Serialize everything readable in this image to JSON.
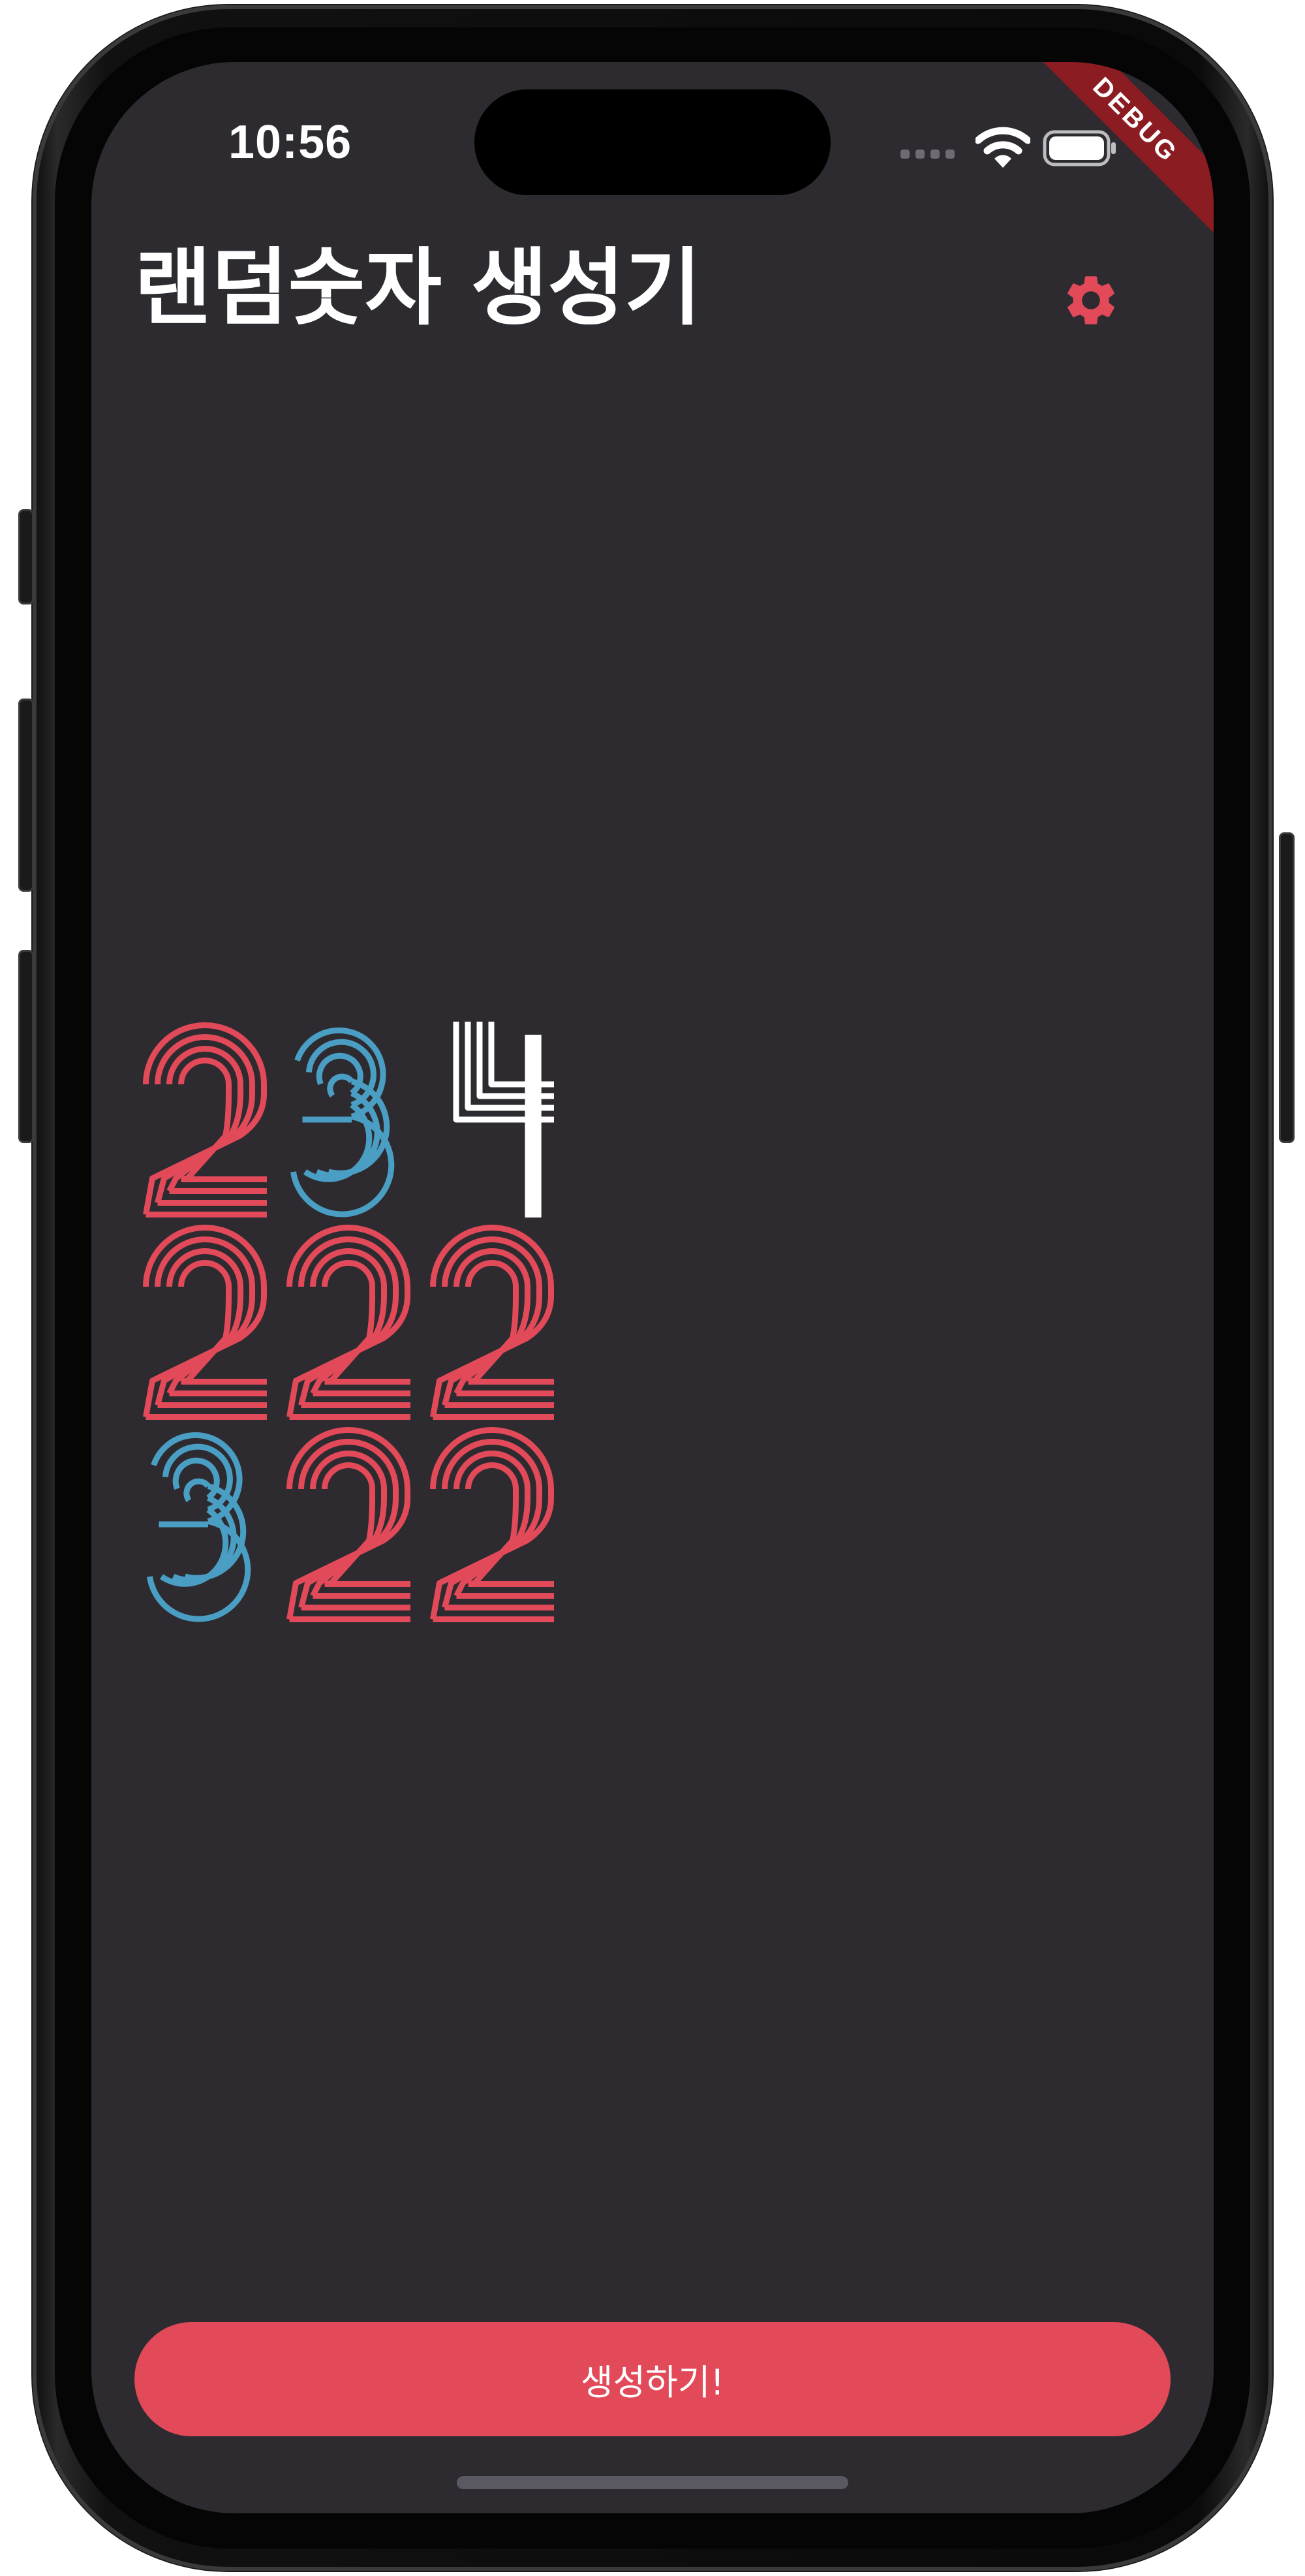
{
  "status_bar": {
    "time": "10:56"
  },
  "debug_banner": "DEBUG",
  "app_bar": {
    "title": "랜덤숫자 생성기",
    "settings_icon": "gear-icon"
  },
  "digit_grid": {
    "rows": [
      [
        "2",
        "3",
        "4"
      ],
      [
        "2",
        "2",
        "2"
      ],
      [
        "3",
        "2",
        "2"
      ]
    ],
    "colors": {
      "2": "#e24a59",
      "3": "#4a9ec4",
      "4": "#ffffff"
    }
  },
  "generate_button": {
    "label": "생성하기!"
  },
  "theme": {
    "background": "#2d2b30",
    "accent": "#e24a59"
  }
}
